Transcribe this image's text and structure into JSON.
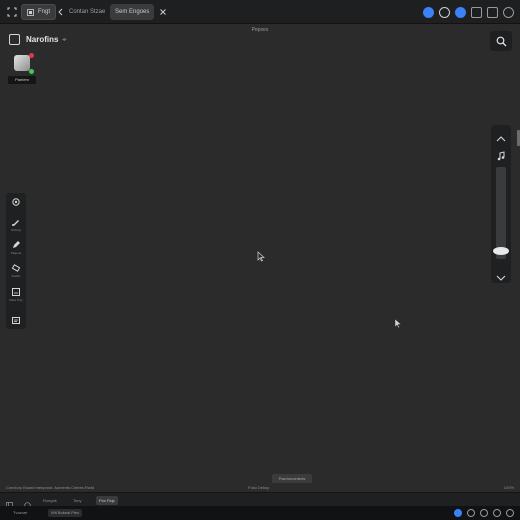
{
  "titlebar": {
    "file_label": "Fngt",
    "tabs": [
      "Contan Stzae",
      "Sem Engoes"
    ]
  },
  "canvas": {
    "caption": "Pepxes",
    "project_title": "Narofins",
    "layer_label": "Pantem"
  },
  "tools": [
    {
      "icon": "settings-icon",
      "label": ""
    },
    {
      "icon": "brush-icon",
      "label": "Rsbntg"
    },
    {
      "icon": "pencil-icon",
      "label": "Paqerte"
    },
    {
      "icon": "eraser-icon",
      "label": "Rodsh"
    },
    {
      "icon": "select-icon",
      "label": "Mars Tuty"
    },
    {
      "icon": "chat-icon",
      "label": ""
    }
  ],
  "right_panel": {
    "slider_level": 0.9
  },
  "bottom": {
    "chip_label": "Pacrlorconteds",
    "status_left": "Cnectory Esand menprost. Aoments Cetees Rwtd",
    "status_center": "Foko Deksy",
    "status_right": "100%"
  },
  "bottom_tabs": [
    "Ruegnk",
    "Tony",
    "Poc Fiqs"
  ],
  "taskbar": [
    "Tvozoer",
    "Wlt Bokeal Pies"
  ],
  "colors": {
    "background": "#2b2b2c",
    "panel": "#1f2021",
    "accent_blue": "#3b82f6",
    "red_dot": "#e0364e",
    "green_dot": "#3ecb55"
  }
}
